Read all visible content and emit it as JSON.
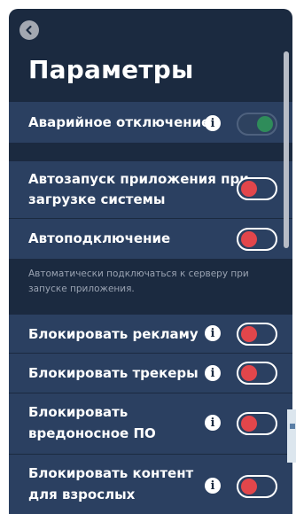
{
  "header": {
    "back_icon": "chevron-left-icon",
    "title": "Параметры"
  },
  "settings": {
    "kill_switch": {
      "label": "Аварийное отключение",
      "has_info": true,
      "enabled": true
    },
    "autostart": {
      "line1": "Автозапуск приложения при",
      "line2": "загрузке системы",
      "has_info": false,
      "enabled": false
    },
    "autoconnect": {
      "label": "Автоподключение",
      "has_info": false,
      "enabled": false,
      "description_line1": "Автоматически подключаться к серверу при",
      "description_line2": "запуске приложения."
    },
    "block_ads": {
      "label": "Блокировать рекламу",
      "has_info": true,
      "enabled": false
    },
    "block_trackers": {
      "label": "Блокировать трекеры",
      "has_info": true,
      "enabled": false
    },
    "block_malware": {
      "line1": "Блокировать",
      "line2": "вредоносное ПО",
      "has_info": true,
      "enabled": false
    },
    "block_adult": {
      "line1": "Блокировать контент",
      "line2": "для взрослых",
      "has_info": true,
      "enabled": false
    }
  },
  "info_glyph": "i",
  "colors": {
    "panel_bg": "#1b2a40",
    "row_bg": "#2b4061",
    "toggle_off_knob": "#e2464b",
    "toggle_on_knob": "#2f8c5a",
    "description_text": "#9aa3b2"
  }
}
